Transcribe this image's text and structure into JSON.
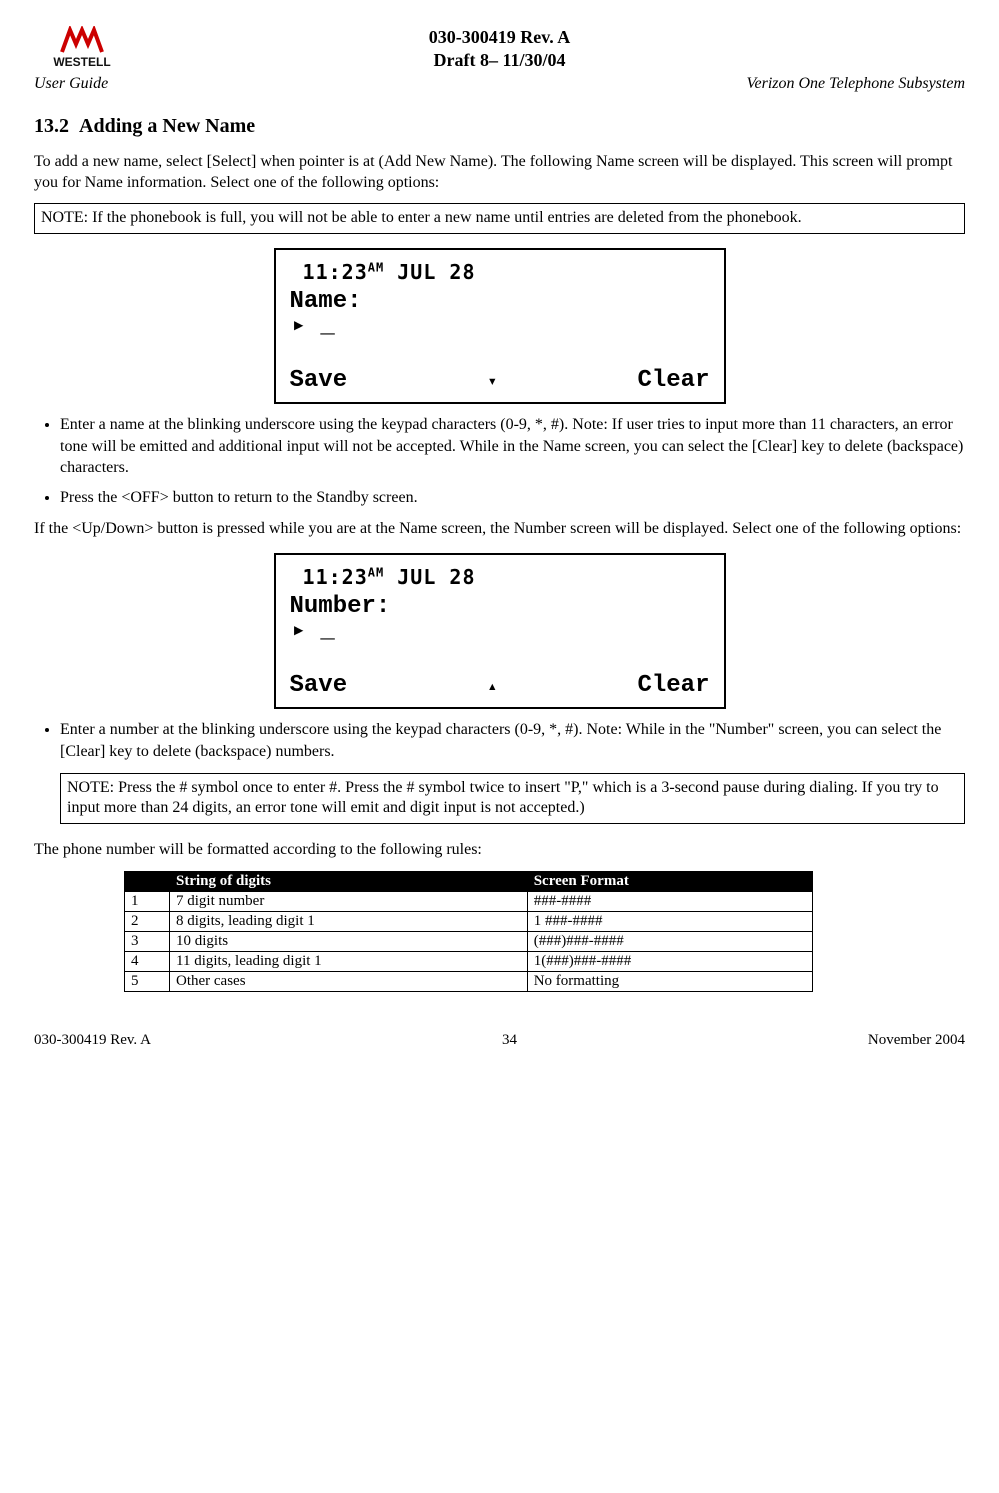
{
  "header": {
    "logo_text": "WESTELL",
    "doc_id": "030-300419 Rev. A",
    "draft": "Draft 8– 11/30/04",
    "user_guide": "User Guide",
    "right_title": "Verizon One Telephone Subsystem"
  },
  "section": {
    "number": "13.2",
    "title": "Adding a New Name"
  },
  "para_intro": "To add a new name, select [Select] when pointer is at (Add New Name). The following Name screen will be displayed. This screen will prompt you for Name information. Select one of the following options:",
  "note1": "NOTE: If the phonebook is full, you will not be able to enter a new name until entries are deleted from the phonebook.",
  "lcd1": {
    "time_h": "11:23",
    "ampm": "AM",
    "date": "JUL 28",
    "label": "Name:",
    "cursor": "▸ _",
    "left": "Save",
    "arrow": "▾",
    "right": "Clear"
  },
  "bullets1": [
    "Enter a name at the blinking underscore using the keypad characters (0-9, *, #). Note: If user tries to input more than 11 characters, an error tone will be emitted and additional input will not be accepted. While in the Name screen, you can select the [Clear] key to delete (backspace) characters.",
    "Press the <OFF> button to return to the Standby screen."
  ],
  "para_mid": "If the <Up/Down> button is pressed while you are at the Name screen, the Number screen will be displayed. Select one of the following options:",
  "lcd2": {
    "time_h": "11:23",
    "ampm": "AM",
    "date": "JUL 28",
    "label": "Number:",
    "cursor": "▸ _",
    "left": "Save",
    "arrow": "▴",
    "right": "Clear"
  },
  "bullets2": [
    "Enter a number at the blinking underscore using the keypad characters (0-9, *, #). Note: While in the \"Number\" screen, you can select the [Clear] key to delete (backspace) numbers."
  ],
  "note2": "NOTE: Press the # symbol once to enter  #. Press the # symbol twice to insert \"P,\" which is a 3-second pause during dialing. If you try to input more than 24 digits, an error tone will emit and digit input is not accepted.)",
  "para_table_intro": "The phone number will be formatted according to the following rules:",
  "table": {
    "headers": [
      "",
      "String of digits",
      "Screen Format"
    ],
    "rows": [
      [
        "1",
        "7 digit number",
        "###-####"
      ],
      [
        "2",
        "8 digits, leading digit 1",
        "1 ###-####"
      ],
      [
        "3",
        "10 digits",
        "(###)###-####"
      ],
      [
        "4",
        "11 digits, leading digit 1",
        "1(###)###-####"
      ],
      [
        "5",
        "Other cases",
        "No formatting"
      ]
    ]
  },
  "footer": {
    "left": "030-300419 Rev. A",
    "center": "34",
    "right": "November 2004"
  }
}
